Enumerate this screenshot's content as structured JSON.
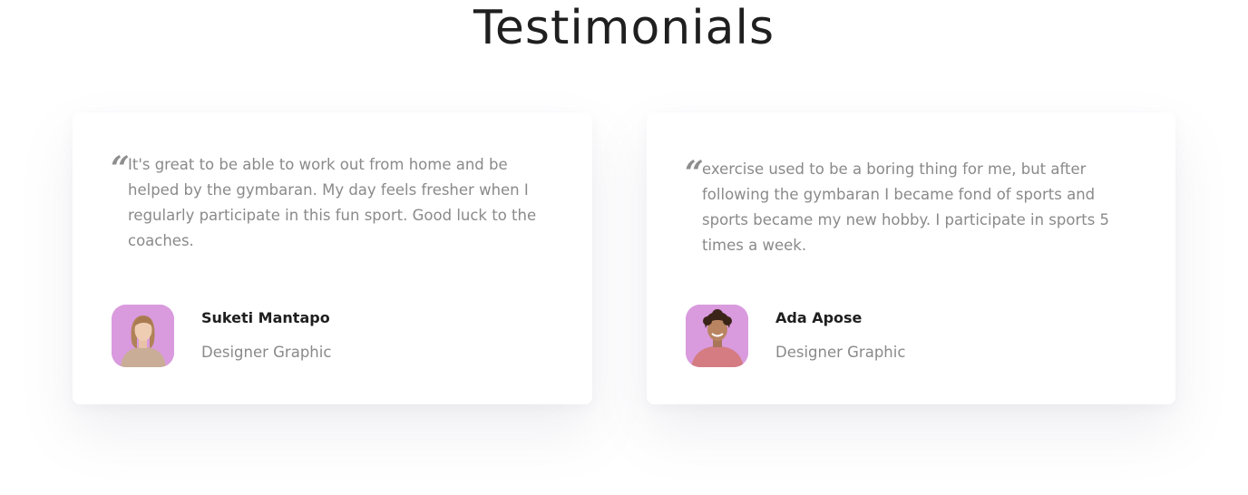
{
  "section": {
    "title": "Testimonials"
  },
  "testimonials": [
    {
      "quote_mark": "“",
      "text": "It's great to be able to work out from home and be helped by the gymbaran. My day feels fresher when I regularly participate in this fun sport. Good luck to the coaches.",
      "name": "Suketi Mantapo",
      "role": "Designer Graphic",
      "avatar_icon": "woman-portrait-avatar",
      "avatar_bg": "#d99bde"
    },
    {
      "quote_mark": "“",
      "text": "exercise used to be a boring thing for me, but after following the gymbaran I became fond of sports and sports became my new hobby. I participate in sports 5 times a week.",
      "name": "Ada Apose",
      "role": "Designer Graphic",
      "avatar_icon": "man-portrait-avatar",
      "avatar_bg": "#d99bde"
    }
  ]
}
